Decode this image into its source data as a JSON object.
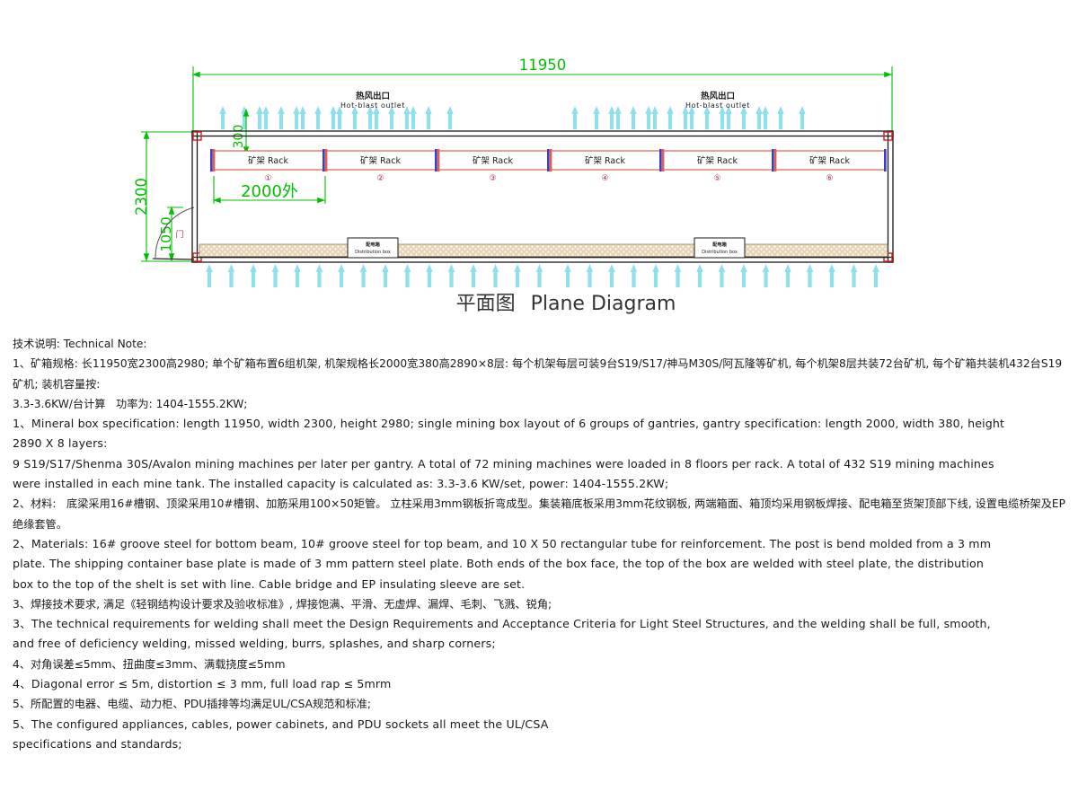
{
  "drawing": {
    "title_cn": "平面图",
    "title_en": "Plane Diagram",
    "dimensions": {
      "overall_length": "11950",
      "overall_width": "2300",
      "door_width": "1050",
      "gantry_pitch": "2000外",
      "top_gap": "300"
    },
    "door_label": "门",
    "hot_blast": {
      "cn": "热风出口",
      "en": "Hot-blast outlet"
    },
    "distribution_box": {
      "cn": "配电箱",
      "en": "Distribution box"
    },
    "rack_label_cn": "矿架",
    "rack_label_en": "Rack",
    "racks": [
      {
        "index": "①",
        "label_cn": "矿架",
        "label_en": "Rack"
      },
      {
        "index": "②",
        "label_cn": "矿架",
        "label_en": "Rack"
      },
      {
        "index": "③",
        "label_cn": "矿架",
        "label_en": "Rack"
      },
      {
        "index": "④",
        "label_cn": "矿架",
        "label_en": "Rack"
      },
      {
        "index": "⑤",
        "label_cn": "矿架",
        "label_en": "Rack"
      },
      {
        "index": "⑥",
        "label_cn": "矿架",
        "label_en": "Rack"
      }
    ],
    "colors": {
      "dimension_green": "#00c000",
      "airflow_cyan": "#66d9e8",
      "rack_orange": "#e07a5f",
      "rack_blue": "#3b3bd0",
      "outline_black": "#1a1a1a",
      "door_red": "#d02020",
      "index_magenta": "#b03060",
      "floor_tan": "#d8b88a"
    }
  },
  "notes": {
    "heading": "技术说明: Technical Note:",
    "lines": [
      {
        "lang": "cn",
        "text": "1、矿箱规格: 长11950宽2300高2980; 单个矿箱布置6组机架, 机架规格长2000宽380高2890×8层: 每个机架每层可装9台S19/S17/神马M30S/阿瓦隆等矿机, 每个机架8层共装72台矿机, 每个矿箱共装机432台S19矿机; 装机容量按:"
      },
      {
        "lang": "cn",
        "text": "3.3-3.6KW/台计算   功率为: 1404-1555.2KW;"
      },
      {
        "lang": "en",
        "text": "1、Mineral box specification: length 11950, width 2300, height 2980; single mining box layout of 6 groups of gantries, gantry specification: length 2000, width 380, height"
      },
      {
        "lang": "en",
        "text": "2890 X 8 layers:"
      },
      {
        "lang": "en",
        "text": "9 S19/S17/Shenma 30S/Avalon mining machines per later per gantry. A total of 72 mining machines were loaded in 8 floors per rack. A total of 432 S19 mining machines"
      },
      {
        "lang": "en",
        "text": "were installed in each mine tank. The installed capacity is calculated as: 3.3-3.6 KW/set, power: 1404-1555.2KW;"
      },
      {
        "lang": "cn",
        "text": "2、材料:   底梁采用16#槽钢、顶梁采用10#槽钢、加筋采用100×50矩管。 立柱采用3mm钢板折弯成型。集装箱底板采用3mm花纹钢板, 两端箱面、箱顶均采用钢板焊接、配电箱至货架顶部下线, 设置电缆桥架及EP绝缘套管。"
      },
      {
        "lang": "en",
        "text": "2、Materials: 16# groove steel for bottom beam, 10# groove steel for top beam, and 10 X 50 rectangular tube for reinforcement. The post is bend molded from a 3 mm"
      },
      {
        "lang": "en",
        "text": "plate. The shipping container base plate is made of 3 mm pattern steel plate. Both ends of the box face, the top of the box are welded with steel plate, the distribution"
      },
      {
        "lang": "en",
        "text": "box to the top of the shelt is set with line. Cable bridge and EP insulating sleeve are set."
      },
      {
        "lang": "cn",
        "text": "3、焊接技术要求, 满足《轻钢结构设计要求及验收标准》, 焊接饱满、平滑、无虚焊、漏焊、毛刺、飞溅、锐角;"
      },
      {
        "lang": "en",
        "text": "3、The technical requirements for welding shall meet the Design Requirements and Acceptance Criteria for Light Steel Structures, and the welding shall be full, smooth,"
      },
      {
        "lang": "en",
        "text": "and free of deficiency welding, missed welding, burrs, splashes, and sharp corners;"
      },
      {
        "lang": "cn",
        "text": "4、对角误差≤5mm、扭曲度≤3mm、满载挠度≤5mm"
      },
      {
        "lang": "en",
        "text": "4、Diagonal error ≤ 5m, distortion ≤ 3 mm, full load rap ≤ 5mrm"
      },
      {
        "lang": "cn",
        "text": "5、所配置的电器、电缆、动力柜、PDU插排等均满足UL/CSA规范和标准;"
      },
      {
        "lang": "en",
        "text": "5、The configured appliances, cables, power cabinets, and PDU sockets all meet the UL/CSA"
      },
      {
        "lang": "en",
        "text": "specifications and standards;"
      }
    ]
  }
}
